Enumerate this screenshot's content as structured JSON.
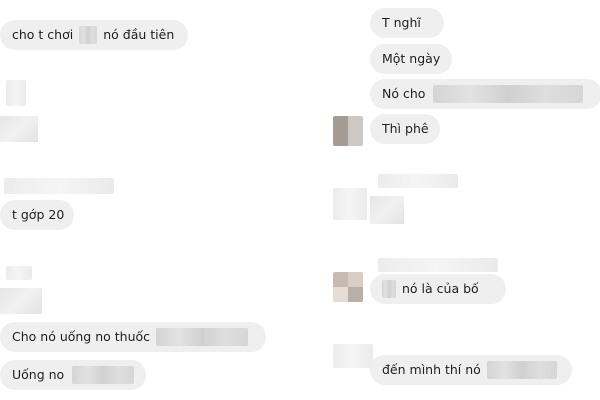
{
  "left": {
    "msg1": {
      "before": "cho t chơi",
      "after": "nó đầu tiên"
    },
    "msg2": "t gớp 20",
    "msg3": {
      "text": "Cho nó uống no thuốc"
    },
    "msg4": {
      "text": "Uống no"
    }
  },
  "right": {
    "msg1": "T nghĩ",
    "msg2": "Một ngày",
    "msg3": {
      "text": "Nó cho"
    },
    "msg4": "Thì phê",
    "msg5": {
      "text": "nó là của bố"
    },
    "msg6": {
      "text": "đến mình thí nó"
    }
  }
}
